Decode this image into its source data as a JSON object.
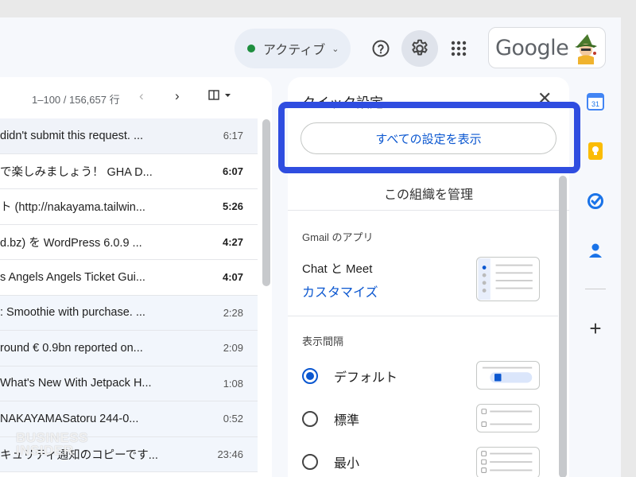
{
  "header": {
    "status_label": "アクティブ",
    "tooltip": "設定",
    "google_logo": "Google",
    "icons": [
      "help-icon",
      "gear-icon",
      "apps-grid-icon",
      "avatar"
    ]
  },
  "mail": {
    "pager": "1–100 / 156,657 行",
    "rows": [
      {
        "snippet": "didn't submit this request. ...",
        "time": "6:17",
        "unread": false
      },
      {
        "snippet": "で楽しみましょう！ GHA D...",
        "time": "6:07",
        "unread": true
      },
      {
        "snippet": "ト (http://nakayama.tailwin...",
        "time": "5:26",
        "unread": true
      },
      {
        "snippet": "d.bz) を WordPress 6.0.9 ...",
        "time": "4:27",
        "unread": true
      },
      {
        "snippet": "s Angels Angels Ticket Gui...",
        "time": "4:07",
        "unread": true
      },
      {
        "snippet": ": Smoothie with purchase. ...",
        "time": "2:28",
        "unread": false
      },
      {
        "snippet": "round € 0.9bn reported on...",
        "time": "2:09",
        "unread": false
      },
      {
        "snippet": "What's New With Jetpack H...",
        "time": "1:08",
        "unread": false
      },
      {
        "snippet": " NAKAYAMASatoru 244-0...",
        "time": "0:52",
        "unread": false
      },
      {
        "snippet": "キュリティ通知のコピーです...",
        "time": "23:46",
        "unread": false
      }
    ],
    "watermark_line1": "BUSINESS",
    "watermark_line2": "INSIDER"
  },
  "quick_settings": {
    "title": "クイック設定",
    "all_settings_button": "すべての設定を表示",
    "manage_org": "この組織を管理",
    "gmail_apps_label": "Gmail のアプリ",
    "chat_meet": "Chat と Meet",
    "customize": "カスタマイズ",
    "density_label": "表示間隔",
    "density_options": [
      {
        "label": "デフォルト",
        "selected": true
      },
      {
        "label": "標準",
        "selected": false
      },
      {
        "label": "最小",
        "selected": false
      }
    ]
  },
  "side_rail": {
    "icons": [
      "calendar-icon",
      "keep-icon",
      "tasks-icon",
      "contacts-icon",
      "add-icon"
    ],
    "calendar_day": "31"
  },
  "colors": {
    "highlight_border": "#2f4de0",
    "accent_blue": "#0b57d0",
    "status_green": "#1e8e3e"
  }
}
